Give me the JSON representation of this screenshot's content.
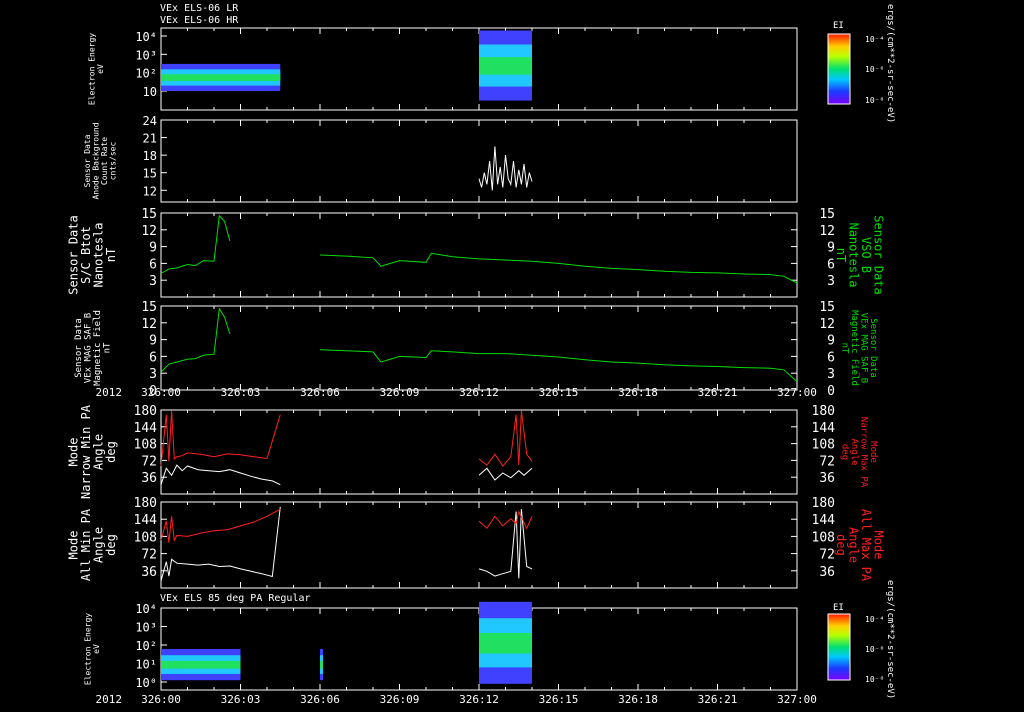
{
  "header": {
    "title_lr": "VEx ELS-06 LR",
    "title_hr": "VEx ELS-06 HR",
    "bottom_title": "VEx ELS 85 deg PA Regular"
  },
  "colorbar": {
    "label": "EI",
    "units": "ergs/(cm**2-sr-sec-eV)",
    "top_ticks": [
      "10⁻⁴",
      "10⁻⁶",
      "10⁻⁸"
    ],
    "bottom_ticks": [
      "10⁻⁴",
      "10⁻⁶",
      "10⁻⁸"
    ]
  },
  "time_axis": {
    "year": "2012",
    "ticks": [
      "326:00",
      "326:03",
      "326:06",
      "326:09",
      "326:12",
      "326:15",
      "326:18",
      "326:21",
      "327:00"
    ]
  },
  "colors": {
    "frame": "#ffffff",
    "green": "#00dd00",
    "red": "#ff2020",
    "white": "#ffffff"
  },
  "chart_data": [
    {
      "type": "heatmap",
      "panel": "spectrogram-top",
      "ylabel_lines": [
        "Electron Energy",
        "eV"
      ],
      "yscale": "log",
      "y_ticks": [
        "10⁴",
        "10³",
        "10²",
        "10"
      ],
      "segments": [
        {
          "t_start": 0.0,
          "t_end": 4.5,
          "energy_band_eV": [
            10,
            300
          ]
        },
        {
          "t_start": 12.0,
          "t_end": 14.0,
          "energy_band_eV": [
            3,
            20000
          ]
        }
      ]
    },
    {
      "type": "line",
      "panel": "anode-background",
      "ylabel_lines": [
        "Sensor Data",
        "Anode Background",
        "Count Rate",
        "cnts/sec"
      ],
      "ylim": [
        10,
        24
      ],
      "y_ticks": [
        "24",
        "21",
        "18",
        "15",
        "12"
      ],
      "series": [
        {
          "color": "white",
          "x": [
            12.0,
            12.1,
            12.2,
            12.3,
            12.4,
            12.5,
            12.6,
            12.7,
            12.8,
            12.9,
            13.0,
            13.1,
            13.2,
            13.3,
            13.4,
            13.5,
            13.6,
            13.7,
            13.8,
            13.9,
            14.0
          ],
          "values": [
            14,
            12.5,
            15,
            13,
            17,
            12,
            19.5,
            13,
            16,
            12.5,
            18,
            14,
            13,
            17,
            12.5,
            15.5,
            13,
            16.5,
            12.5,
            15,
            13.5
          ]
        }
      ]
    },
    {
      "type": "line",
      "panel": "s-c-bxyz",
      "ylabel_lines": [
        "Sensor Data",
        "S/C Btot",
        "Nanotesla",
        "nT"
      ],
      "ylabel_right_lines": [
        "Sensor Data",
        "VSO B",
        "Nanotesla",
        "nT"
      ],
      "ylim": [
        0,
        15
      ],
      "y_ticks": [
        "15",
        "12",
        "9",
        "6",
        "3"
      ],
      "series": [
        {
          "color": "green",
          "x": [
            0.0,
            0.3,
            0.6,
            1.0,
            1.3,
            1.6,
            2.0,
            2.1,
            2.2,
            2.4,
            2.6,
            6.0,
            7.0,
            8.0,
            8.3,
            9.0,
            10.0,
            10.2,
            11.0,
            12.0,
            13.0,
            14.0,
            15.0,
            16.0,
            17.0,
            18.0,
            19.0,
            20.0,
            21.0,
            22.0,
            23.0,
            23.5,
            24.0
          ],
          "values": [
            4.2,
            5.0,
            5.2,
            5.8,
            5.6,
            6.5,
            6.4,
            10.5,
            14.5,
            13.5,
            10.0,
            7.5,
            7.3,
            7.0,
            5.5,
            6.5,
            6.2,
            7.8,
            7.2,
            6.8,
            6.6,
            6.4,
            6.0,
            5.5,
            5.1,
            4.9,
            4.6,
            4.4,
            4.3,
            4.1,
            4.0,
            3.7,
            2.5
          ]
        }
      ]
    },
    {
      "type": "line",
      "panel": "mag-saf",
      "ylabel_lines": [
        "Sensor Data",
        "VEx MAG SAF_B",
        "Magnetic Field",
        "nT"
      ],
      "ylabel_right_lines": [
        "Sensor Data",
        "VEx MAG SAF_B",
        "Magnetic Field",
        "nT"
      ],
      "ylim": [
        0,
        15
      ],
      "y_ticks": [
        "15",
        "12",
        "9",
        "6",
        "3",
        "0"
      ],
      "series": [
        {
          "color": "green",
          "x": [
            0.0,
            0.3,
            0.6,
            1.0,
            1.3,
            1.6,
            2.0,
            2.1,
            2.2,
            2.4,
            2.6,
            6.0,
            7.0,
            8.0,
            8.3,
            9.0,
            10.0,
            10.2,
            11.0,
            12.0,
            13.0,
            14.0,
            15.0,
            16.0,
            17.0,
            18.0,
            19.0,
            20.0,
            21.0,
            22.0,
            23.0,
            23.5,
            24.0
          ],
          "values": [
            3.2,
            4.6,
            5.0,
            5.5,
            5.6,
            6.2,
            6.4,
            10.5,
            14.5,
            13.0,
            10.0,
            7.2,
            7.0,
            6.8,
            5.0,
            6.0,
            5.8,
            7.0,
            6.8,
            6.5,
            6.5,
            6.2,
            5.9,
            5.4,
            5.0,
            4.8,
            4.5,
            4.3,
            4.2,
            4.0,
            3.9,
            3.6,
            1.5
          ]
        }
      ]
    },
    {
      "type": "line",
      "panel": "narrow-pa",
      "ylabel_lines": [
        "Mode",
        "Narrow Min PA",
        "Angle",
        "deg"
      ],
      "ylabel_right_lines": [
        "Mode",
        "Narrow Max PA",
        "Angle",
        "deg"
      ],
      "ylim": [
        0,
        180
      ],
      "y_ticks": [
        "180",
        "144",
        "108",
        "72",
        "36"
      ],
      "series": [
        {
          "color": "white",
          "x": [
            0.0,
            0.2,
            0.4,
            0.6,
            0.8,
            1.0,
            1.4,
            1.8,
            2.2,
            2.6,
            3.0,
            3.4,
            3.8,
            4.2,
            4.5,
            12.0,
            12.3,
            12.6,
            12.9,
            13.2,
            13.5,
            13.7,
            14.0
          ],
          "values": [
            20,
            55,
            40,
            62,
            50,
            60,
            52,
            50,
            48,
            52,
            45,
            38,
            32,
            28,
            20,
            40,
            55,
            30,
            45,
            35,
            50,
            40,
            55
          ]
        },
        {
          "color": "red",
          "x": [
            0.0,
            0.2,
            0.3,
            0.4,
            0.5,
            0.6,
            0.8,
            1.0,
            1.5,
            2.0,
            2.5,
            3.0,
            3.5,
            4.0,
            4.5,
            12.0,
            12.3,
            12.6,
            12.9,
            13.2,
            13.4,
            13.5,
            13.6,
            13.8,
            14.0
          ],
          "values": [
            60,
            170,
            70,
            178,
            75,
            80,
            82,
            88,
            85,
            80,
            86,
            84,
            80,
            76,
            170,
            75,
            62,
            85,
            60,
            80,
            170,
            62,
            178,
            85,
            70
          ]
        }
      ]
    },
    {
      "type": "line",
      "panel": "all-pa",
      "ylabel_lines": [
        "Mode",
        "All Min PA",
        "Angle",
        "deg"
      ],
      "ylabel_right_lines": [
        "Mode",
        "All Max PA",
        "Angle",
        "deg"
      ],
      "ylim": [
        0,
        180
      ],
      "y_ticks": [
        "180",
        "144",
        "108",
        "72",
        "36"
      ],
      "series": [
        {
          "color": "white",
          "x": [
            0.0,
            0.2,
            0.3,
            0.4,
            0.6,
            1.0,
            1.4,
            1.8,
            2.2,
            2.6,
            3.0,
            3.4,
            3.8,
            4.2,
            4.5,
            12.0,
            12.3,
            12.6,
            12.9,
            13.2,
            13.4,
            13.5,
            13.6,
            13.8,
            14.0
          ],
          "values": [
            15,
            55,
            25,
            60,
            52,
            50,
            48,
            50,
            45,
            46,
            40,
            35,
            30,
            24,
            170,
            40,
            35,
            25,
            30,
            35,
            160,
            20,
            165,
            45,
            40
          ]
        },
        {
          "color": "red",
          "x": [
            0.0,
            0.2,
            0.3,
            0.4,
            0.5,
            0.6,
            1.0,
            1.5,
            2.0,
            2.5,
            3.0,
            3.5,
            4.0,
            4.5,
            12.0,
            12.3,
            12.6,
            12.9,
            13.2,
            13.4,
            13.5,
            13.8,
            14.0
          ],
          "values": [
            100,
            140,
            95,
            150,
            100,
            110,
            108,
            115,
            120,
            122,
            130,
            138,
            150,
            165,
            140,
            125,
            150,
            130,
            145,
            135,
            160,
            125,
            150
          ]
        }
      ]
    },
    {
      "type": "heatmap",
      "panel": "spectrogram-bottom",
      "ylabel_lines": [
        "Electron Energy",
        "eV"
      ],
      "yscale": "log",
      "y_ticks": [
        "10⁴",
        "10³",
        "10²",
        "10¹",
        "10⁰"
      ],
      "segments": [
        {
          "t_start": 0.0,
          "t_end": 3.0,
          "energy_band_eV": [
            3,
            100
          ]
        },
        {
          "t_start": 6.0,
          "t_end": 6.1,
          "energy_band_eV": [
            3,
            100
          ]
        },
        {
          "t_start": 12.0,
          "t_end": 14.0,
          "energy_band_eV": [
            2,
            20000
          ]
        }
      ]
    }
  ]
}
